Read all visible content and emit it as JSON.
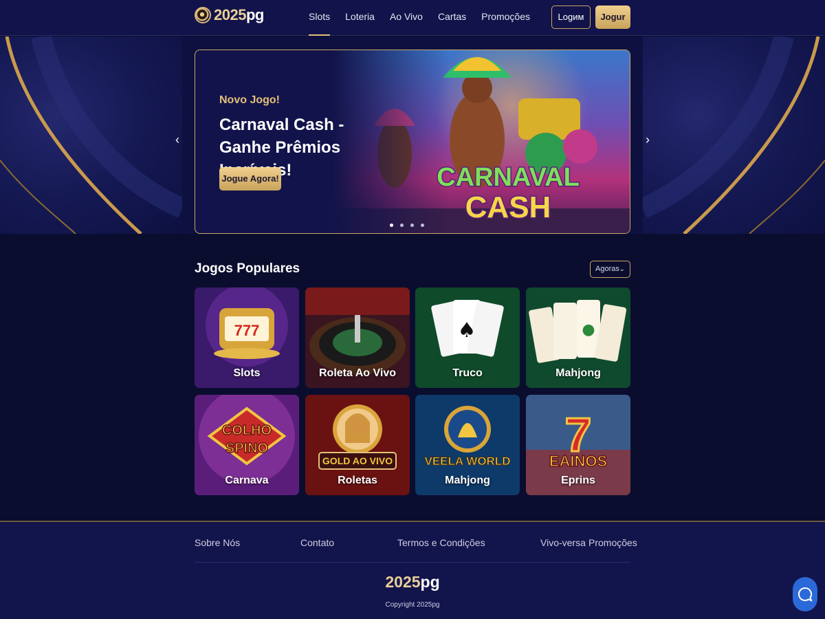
{
  "brand": {
    "name_main": "2025",
    "name_suffix": "pg"
  },
  "nav": {
    "items": [
      {
        "label": "Slots",
        "active": true
      },
      {
        "label": "Loteria"
      },
      {
        "label": "Ao Vivo"
      },
      {
        "label": "Cartas"
      },
      {
        "label": "Promoções"
      }
    ]
  },
  "header": {
    "login_label": "Logим",
    "play_label": "Jogur"
  },
  "carousel": {
    "prev_icon": "chevron-left-icon",
    "next_icon": "chevron-right-icon",
    "kicker": "Novo Jogo!",
    "title": "Carnaval Cash - Ganhe Prêmios Incríveis!",
    "cta_label": "Jogue Agora!",
    "art_text_line1": "CARNAVAL",
    "art_text_line2": "CASH",
    "slide_count": 4,
    "active_slide": 1
  },
  "popular": {
    "title": "Jogos Populares",
    "filter_label": "Agoras",
    "games": [
      {
        "label": "Slots",
        "art": "slot-machine"
      },
      {
        "label": "Roleta Ao Vivo",
        "art": "roulette"
      },
      {
        "label": "Truco",
        "art": "cards"
      },
      {
        "label": "Mahjong",
        "art": "mahjong"
      },
      {
        "label": "Carnava",
        "art": "colho-spino",
        "art_text": "COLHO SPINO"
      },
      {
        "label": "Roletas",
        "art": "gold-ao-vivo",
        "art_text": "GOLD AO VIVO"
      },
      {
        "label": "Mahjong",
        "art": "veela-world",
        "art_text": "VEELA WORLD"
      },
      {
        "label": "Eprins",
        "art": "eainos",
        "art_text": "EAINOS"
      }
    ]
  },
  "footer": {
    "links": [
      "Sobre Nós",
      "Contato",
      "Termos e Condições",
      "Vivo-versa",
      "Promoções"
    ],
    "brand_main": "2025",
    "brand_suffix": "pg",
    "copyright": "Copyright 2025pg"
  },
  "chat": {
    "icon": "chat-bubble-icon"
  },
  "colors": {
    "accent": "#e5c07b",
    "background": "#0b0d2e",
    "header": "#11134a",
    "chat": "#2b69d8"
  }
}
